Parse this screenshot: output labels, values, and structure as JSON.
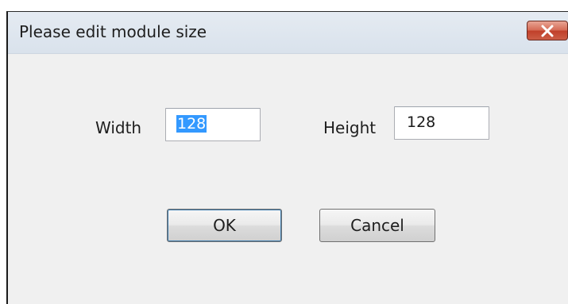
{
  "dialog": {
    "title": "Please edit module size",
    "close_icon": "close-icon"
  },
  "form": {
    "width_label": "Width",
    "width_value": "128",
    "height_label": "Height",
    "height_value": "128"
  },
  "buttons": {
    "ok_label": "OK",
    "cancel_label": "Cancel"
  }
}
